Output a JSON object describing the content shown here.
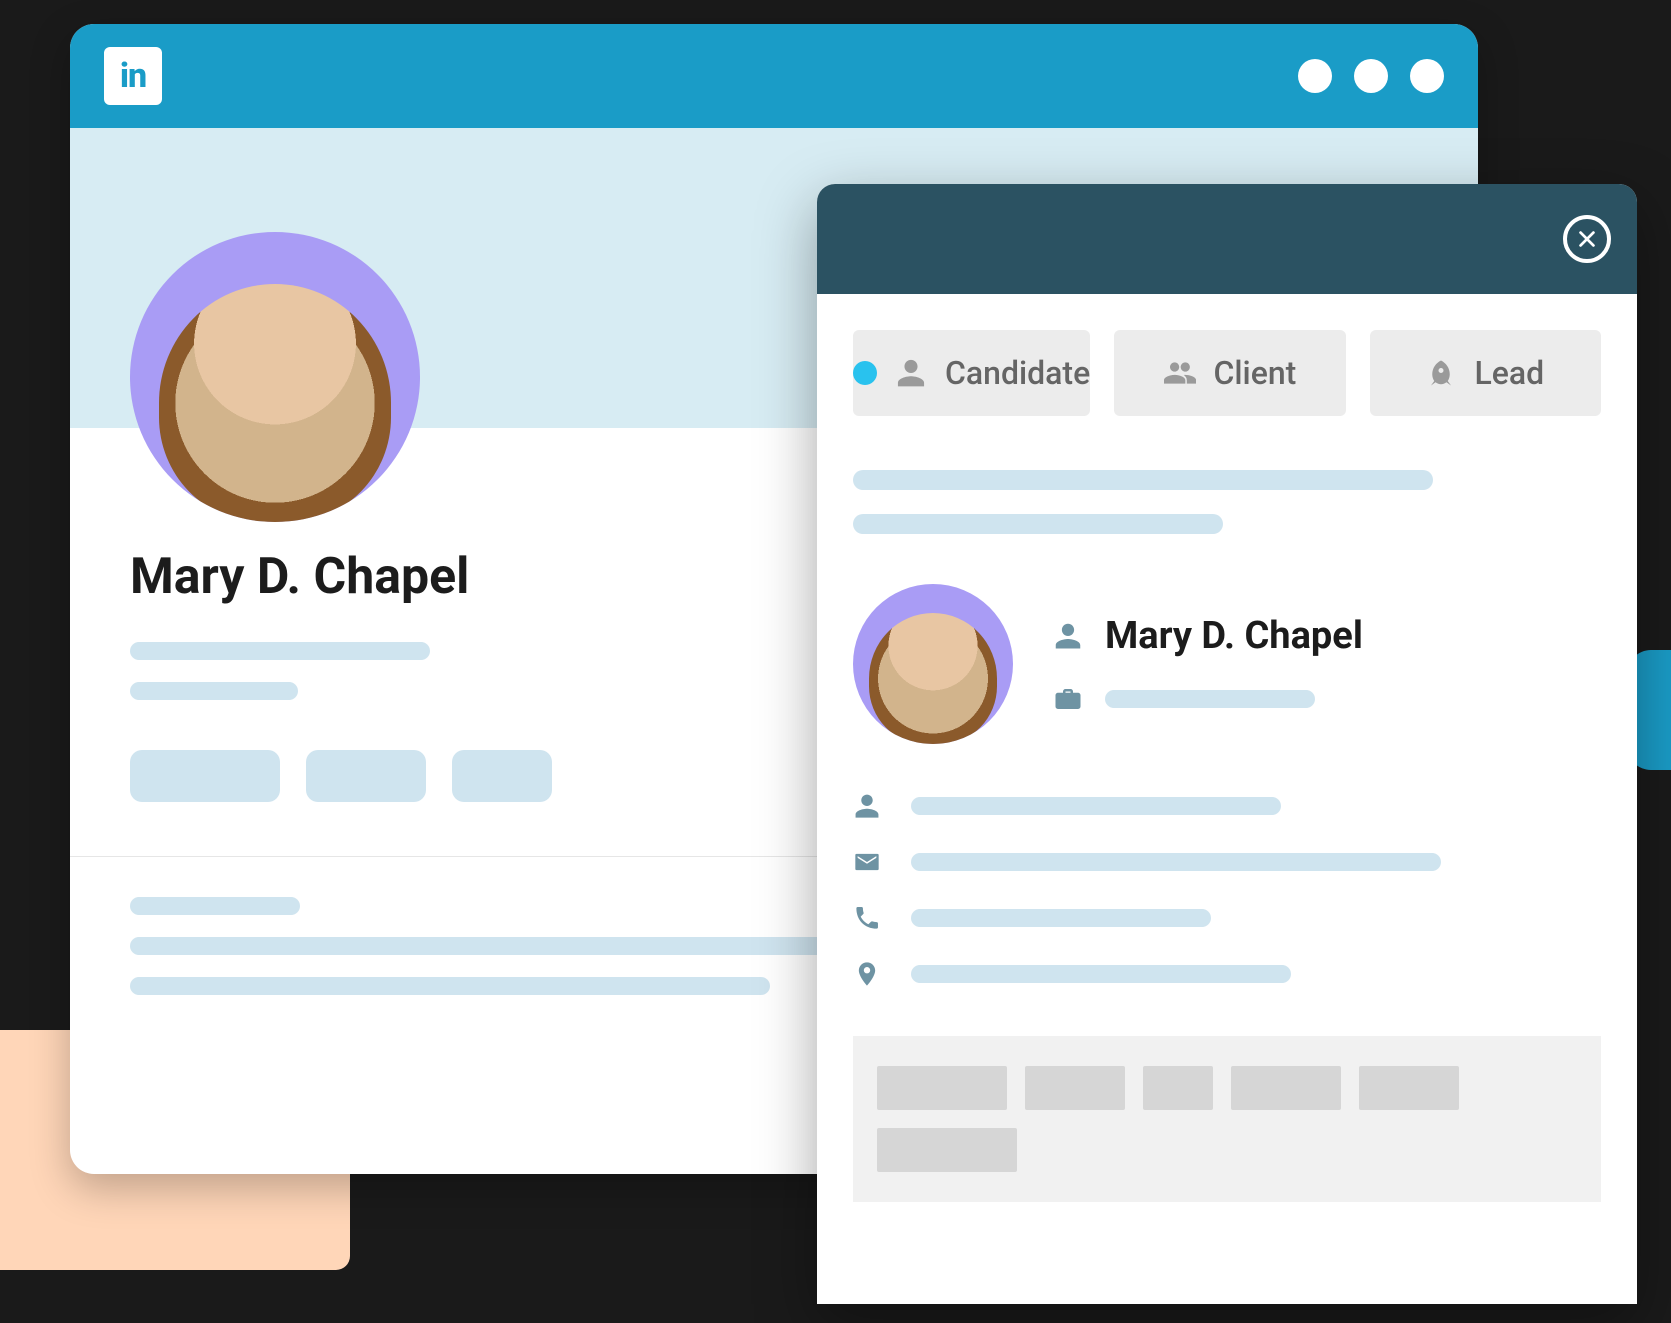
{
  "linkedin": {
    "logo_text": "in",
    "profile_name": "Mary D. Chapel"
  },
  "extension": {
    "tabs": {
      "candidate": "Candidate",
      "client": "Client",
      "lead": "Lead"
    },
    "contact": {
      "name": "Mary D. Chapel"
    }
  },
  "colors": {
    "topbar": "#1a9cc7",
    "ext_header": "#2b5262",
    "skeleton": "#cfe4ef",
    "avatar_bg": "#a99cf5",
    "accent_dot": "#29c2ee"
  }
}
